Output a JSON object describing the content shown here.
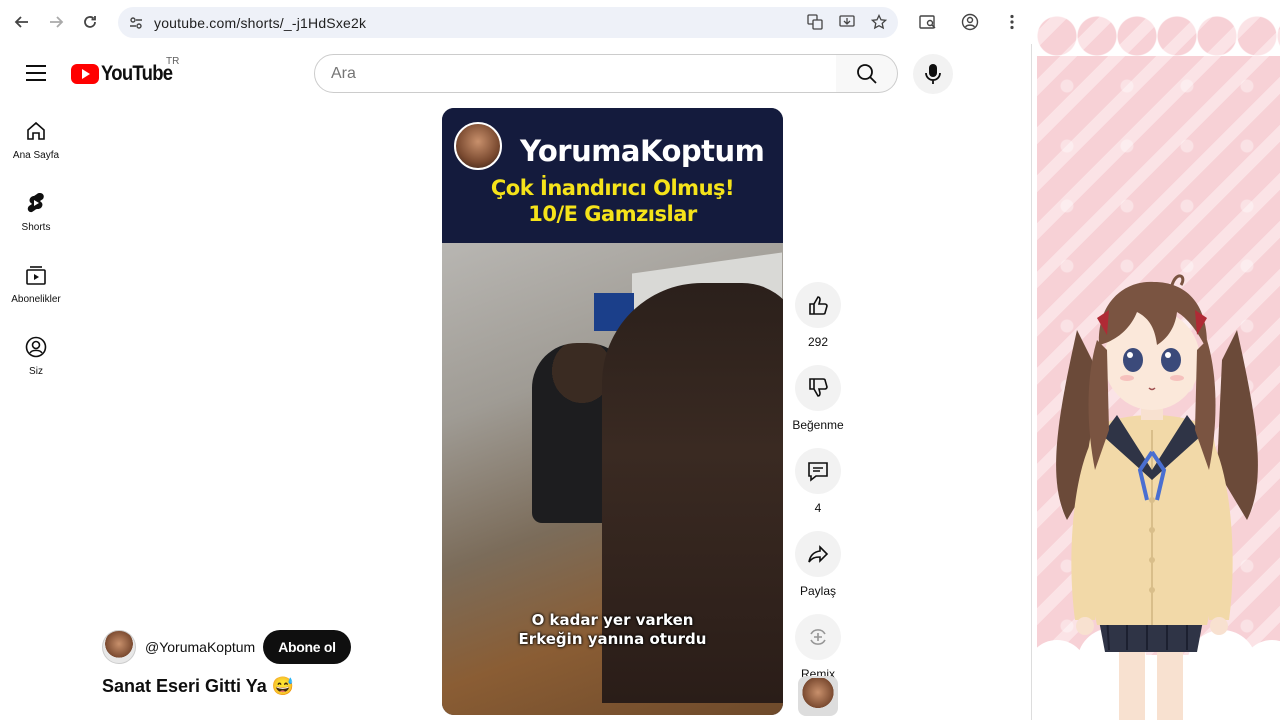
{
  "browser": {
    "url": "youtube.com/shorts/_-j1HdSxe2k"
  },
  "header": {
    "logo_text": "YouTube",
    "region": "TR",
    "search_placeholder": "Ara"
  },
  "sidebar": {
    "items": [
      {
        "label": "Ana Sayfa",
        "icon": "home-icon"
      },
      {
        "label": "Shorts",
        "icon": "shorts-icon"
      },
      {
        "label": "Abonelikler",
        "icon": "subscriptions-icon"
      },
      {
        "label": "Siz",
        "icon": "account-icon"
      }
    ]
  },
  "video": {
    "channel_overlay": "YorumaKoptum",
    "overlay_line1": "Çok İnandırıcı Olmuş!",
    "overlay_line2": "10/E Gamzıslar",
    "subtitle_line1": "O kadar yer varken",
    "subtitle_line2": "Erkeğin yanına oturdu"
  },
  "actions": {
    "like_count": "292",
    "dislike_label": "Beğenme",
    "comment_count": "4",
    "share_label": "Paylaş",
    "remix_label": "Remix"
  },
  "meta": {
    "handle": "@YorumaKoptum",
    "subscribe_label": "Abone ol",
    "title": "Sanat Eseri Gitti Ya 😅"
  },
  "colors": {
    "brand_red": "#ff0000",
    "overlay_yellow": "#f5e31a",
    "panel_pink": "#f7d1d6"
  }
}
